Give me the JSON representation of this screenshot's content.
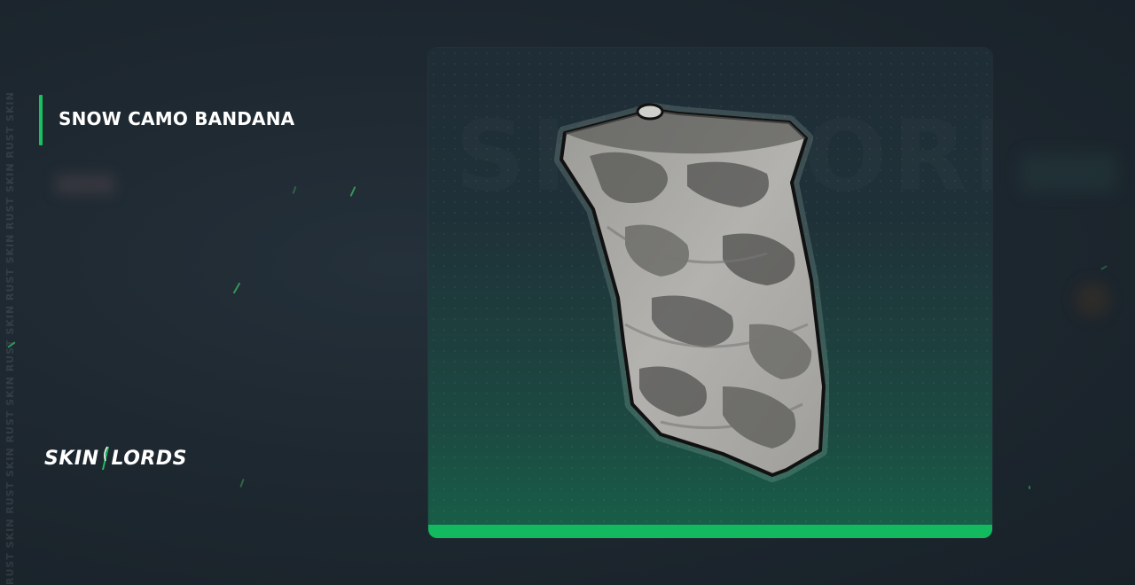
{
  "item": {
    "name": "SNOW CAMO BANDANA",
    "image_icon": "snow-camo-bandana-image"
  },
  "brand": {
    "logo_left": "SKIN",
    "logo_right": "LORDS",
    "watermark": "RUST SKIN RUST SKIN RUST SKIN RUST SKIN RUST SKIN RUST SKIN RUST SKIN"
  },
  "colors": {
    "accent": "#19c161",
    "background": "#1e2830",
    "card_top": "#1f2d36",
    "card_bottom": "#176048"
  }
}
